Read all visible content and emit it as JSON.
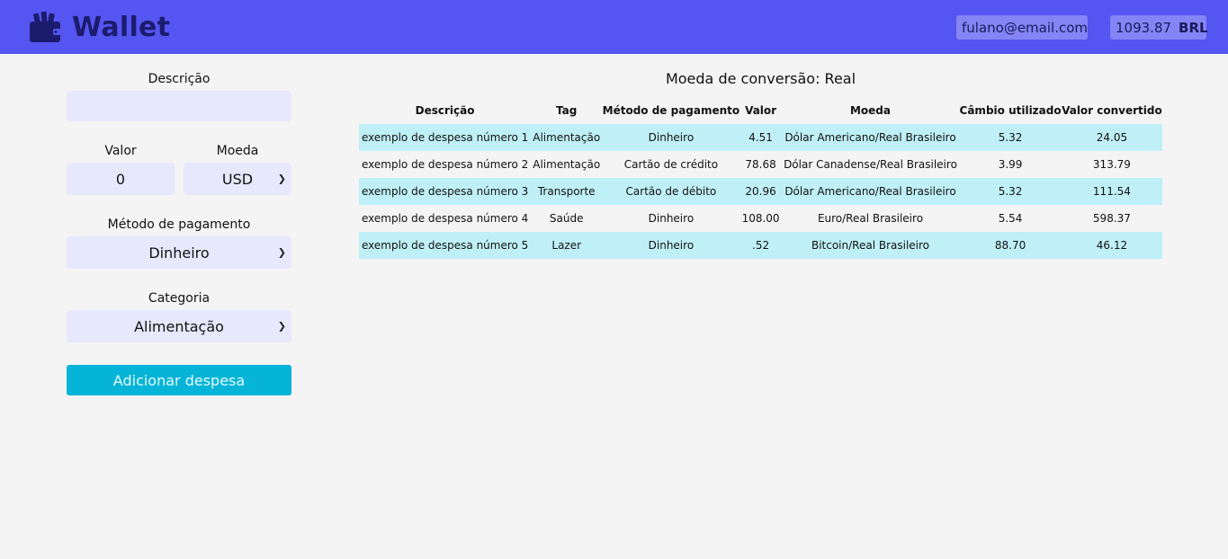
{
  "header": {
    "brand": "Wallet",
    "brand_icon": "wallet-icon",
    "email": "fulano@email.com",
    "total": "1093.87",
    "currency": "BRL",
    "colors": {
      "bar": "#5555f2",
      "brand_text": "#1c1c6e"
    }
  },
  "form": {
    "description_label": "Descrição",
    "description_value": "",
    "value_label": "Valor",
    "value_value": "0",
    "currency_label": "Moeda",
    "currency_value": "USD",
    "method_label": "Método de pagamento",
    "method_value": "Dinheiro",
    "category_label": "Categoria",
    "category_value": "Alimentação",
    "add_button": "Adicionar despesa",
    "colors": {
      "field_bg": "#e8e8fc",
      "button_bg": "#05b4d6"
    }
  },
  "table": {
    "title": "Moeda de conversão: Real",
    "headers": [
      "Descrição",
      "Tag",
      "Método de pagamento",
      "Valor",
      "Moeda",
      "Câmbio utilizado",
      "Valor convertido"
    ],
    "rows": [
      [
        "exemplo de despesa número 1",
        "Alimentação",
        "Dinheiro",
        "4.51",
        "Dólar Americano/Real Brasileiro",
        "5.32",
        "24.05"
      ],
      [
        "exemplo de despesa número 2",
        "Alimentação",
        "Cartão de crédito",
        "78.68",
        "Dólar Canadense/Real Brasileiro",
        "3.99",
        "313.79"
      ],
      [
        "exemplo de despesa número 3",
        "Transporte",
        "Cartão de débito",
        "20.96",
        "Dólar Americano/Real Brasileiro",
        "5.32",
        "111.54"
      ],
      [
        "exemplo de despesa número 4",
        "Saúde",
        "Dinheiro",
        "108.00",
        "Euro/Real Brasileiro",
        "5.54",
        "598.37"
      ],
      [
        "exemplo de despesa número 5",
        "Lazer",
        "Dinheiro",
        ".52",
        "Bitcoin/Real Brasileiro",
        "88.70",
        "46.12"
      ]
    ],
    "colors": {
      "stripe": "#bff0f8"
    }
  }
}
